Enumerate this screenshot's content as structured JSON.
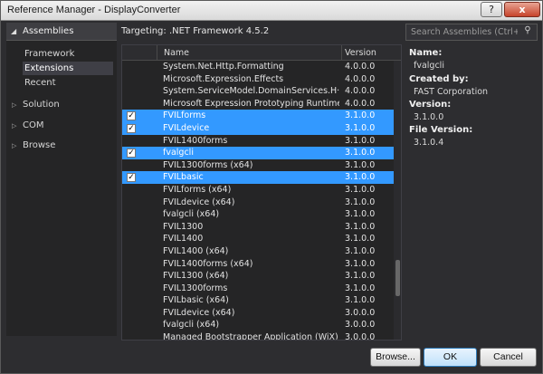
{
  "window": {
    "title": "Reference Manager - DisplayConverter",
    "help_label": "?",
    "close_label": "x"
  },
  "sidebar": {
    "header": "Assemblies",
    "sub_items": [
      "Framework",
      "Extensions",
      "Recent"
    ],
    "selected_sub": "Extensions",
    "categories": [
      "Solution",
      "COM",
      "Browse"
    ]
  },
  "targeting": "Targeting: .NET Framework 4.5.2",
  "search": {
    "placeholder": "Search Assemblies (Ctrl+E)"
  },
  "table": {
    "columns": {
      "name": "Name",
      "version": "Version"
    },
    "rows": [
      {
        "name": "System.Net.Http.Formatting",
        "version": "4.0.0.0",
        "checked": false,
        "selected": false
      },
      {
        "name": "Microsoft.Expression.Effects",
        "version": "4.0.0.0",
        "checked": false,
        "selected": false
      },
      {
        "name": "System.ServiceModel.DomainServices.H···",
        "version": "4.0.0.0",
        "checked": false,
        "selected": false
      },
      {
        "name": "Microsoft Expression Prototyping Runtime",
        "version": "4.0.0.0",
        "checked": false,
        "selected": false
      },
      {
        "name": "FVILforms",
        "version": "3.1.0.0",
        "checked": true,
        "selected": true
      },
      {
        "name": "FVILdevice",
        "version": "3.1.0.0",
        "checked": true,
        "selected": true
      },
      {
        "name": "FVIL1400forms",
        "version": "3.1.0.0",
        "checked": false,
        "selected": false
      },
      {
        "name": "fvalgcli",
        "version": "3.1.0.0",
        "checked": true,
        "selected": true
      },
      {
        "name": "FVIL1300forms (x64)",
        "version": "3.1.0.0",
        "checked": false,
        "selected": false
      },
      {
        "name": "FVILbasic",
        "version": "3.1.0.0",
        "checked": true,
        "selected": true
      },
      {
        "name": "FVILforms (x64)",
        "version": "3.1.0.0",
        "checked": false,
        "selected": false
      },
      {
        "name": "FVILdevice (x64)",
        "version": "3.1.0.0",
        "checked": false,
        "selected": false
      },
      {
        "name": "fvalgcli (x64)",
        "version": "3.1.0.0",
        "checked": false,
        "selected": false
      },
      {
        "name": "FVIL1300",
        "version": "3.1.0.0",
        "checked": false,
        "selected": false
      },
      {
        "name": "FVIL1400",
        "version": "3.1.0.0",
        "checked": false,
        "selected": false
      },
      {
        "name": "FVIL1400 (x64)",
        "version": "3.1.0.0",
        "checked": false,
        "selected": false
      },
      {
        "name": "FVIL1400forms (x64)",
        "version": "3.1.0.0",
        "checked": false,
        "selected": false
      },
      {
        "name": "FVIL1300 (x64)",
        "version": "3.1.0.0",
        "checked": false,
        "selected": false
      },
      {
        "name": "FVIL1300forms",
        "version": "3.1.0.0",
        "checked": false,
        "selected": false
      },
      {
        "name": "FVILbasic (x64)",
        "version": "3.1.0.0",
        "checked": false,
        "selected": false
      },
      {
        "name": "FVILdevice (x64)",
        "version": "3.0.0.0",
        "checked": false,
        "selected": false
      },
      {
        "name": "fvalgcli (x64)",
        "version": "3.0.0.0",
        "checked": false,
        "selected": false
      },
      {
        "name": "Managed Bootstrapper Application (WiX)",
        "version": "3.0.0.0",
        "checked": false,
        "selected": false
      }
    ]
  },
  "details": {
    "name_label": "Name:",
    "name_value": "fvalgcli",
    "createdby_label": "Created by:",
    "createdby_value": "FAST Corporation",
    "version_label": "Version:",
    "version_value": "3.1.0.0",
    "fileversion_label": "File Version:",
    "fileversion_value": "3.1.0.4"
  },
  "buttons": {
    "browse": "Browse...",
    "ok": "OK",
    "cancel": "Cancel"
  },
  "icons": {
    "search": "search-icon",
    "checkbox": "checkmark-icon"
  }
}
